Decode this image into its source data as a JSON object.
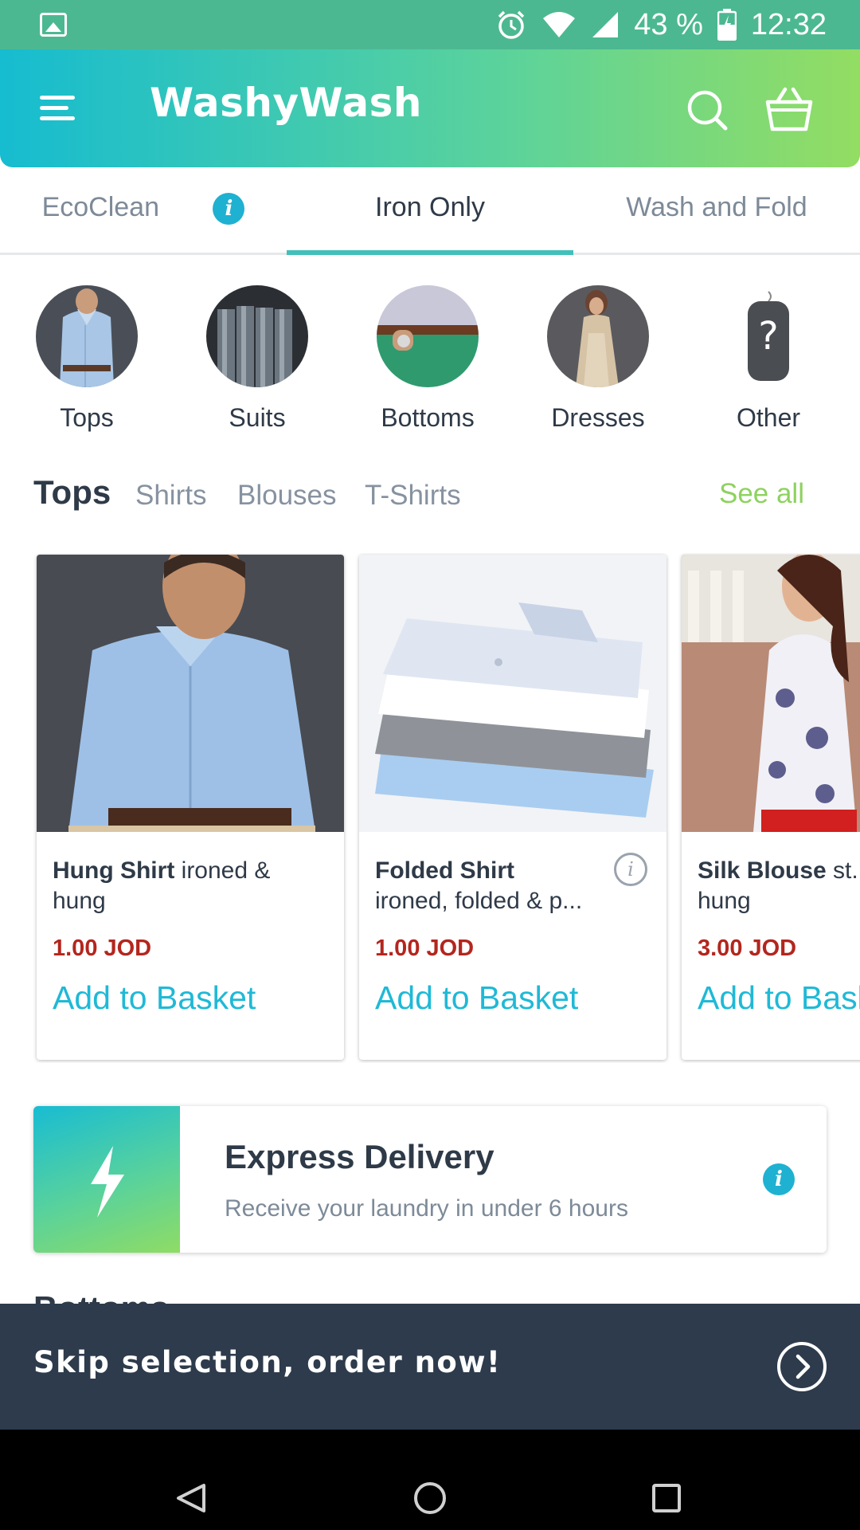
{
  "status_bar": {
    "battery": "43 %",
    "time": "12:32"
  },
  "app_bar": {
    "title": "WashyWash",
    "icons": [
      "menu-icon",
      "search-icon",
      "basket-icon"
    ]
  },
  "tabs": [
    {
      "label": "EcoClean",
      "has_info": true
    },
    {
      "label": "Iron Only",
      "active": true
    },
    {
      "label": "Wash and Fold"
    }
  ],
  "categories": [
    {
      "label": "Tops"
    },
    {
      "label": "Suits"
    },
    {
      "label": "Bottoms"
    },
    {
      "label": "Dresses"
    },
    {
      "label": "Other"
    }
  ],
  "section": {
    "title": "Tops",
    "subcategories": [
      "Shirts",
      "Blouses",
      "T-Shirts"
    ],
    "see_all": "See all"
  },
  "products": [
    {
      "name": "Hung Shirt",
      "desc": " ironed & hung",
      "price": "1.00 JOD",
      "action": "Add to Basket"
    },
    {
      "name": "Folded Shirt",
      "desc": "ironed, folded & p...",
      "price": "1.00 JOD",
      "action": "Add to Basket"
    },
    {
      "name": "Silk Blouse",
      "desc": " st... ironed & hung",
      "price": "3.00 JOD",
      "action": "Add to Basket"
    }
  ],
  "express": {
    "title": "Express Delivery",
    "subtitle": "Receive your laundry in under 6 hours"
  },
  "next_section_peek": "Bottoms",
  "cta": {
    "label": "Skip selection, order now!"
  },
  "colors": {
    "status_bar": "#4cb891",
    "brand_start": "#16bcd0",
    "brand_end": "#93dd62",
    "accent": "#1fb9d6",
    "price": "#b3261e",
    "see_all": "#8ed25f",
    "cta_bg": "#2d3b4c"
  }
}
